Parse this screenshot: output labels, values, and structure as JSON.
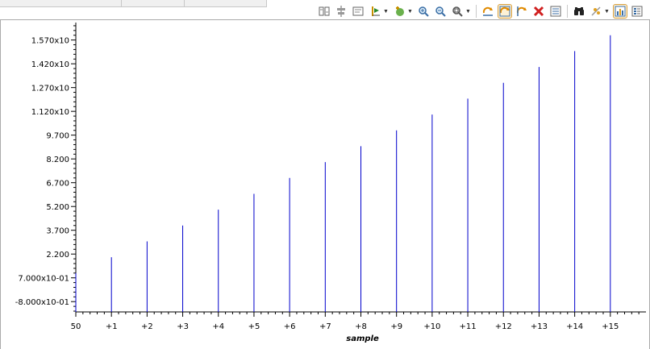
{
  "toolbar": {
    "icons": [
      "align-columns-icon",
      "align-center-icon",
      "frame-icon",
      "cursor-marker-icon",
      "add-point-icon",
      "zoom-in-icon",
      "zoom-out-icon",
      "zoom-fit-icon",
      "autoscale-x-icon",
      "autoscale-xy-icon",
      "autoscale-y-icon",
      "clear-icon",
      "legend-icon",
      "binoculars-icon",
      "plot-style-icon",
      "chart-view-icon",
      "properties-icon"
    ]
  },
  "chart_data": {
    "type": "bar",
    "xlabel": "sample",
    "ylabel": "",
    "x_tick_labels": [
      "50",
      "+1",
      "+2",
      "+3",
      "+4",
      "+5",
      "+6",
      "+7",
      "+8",
      "+9",
      "+10",
      "+11",
      "+12",
      "+13",
      "+14",
      "+15"
    ],
    "y_tick_labels": [
      "-8.000x10-01",
      "7.000x10-01",
      "2.200",
      "3.700",
      "5.200",
      "6.700",
      "8.200",
      "9.700",
      "1.120x10",
      "1.270x10",
      "1.420x10",
      "1.570x10"
    ],
    "y_tick_values": [
      -0.8,
      0.7,
      2.2,
      3.7,
      5.2,
      6.7,
      8.2,
      9.7,
      11.2,
      12.7,
      14.2,
      15.7
    ],
    "x": [
      50,
      51,
      52,
      53,
      54,
      55,
      56,
      57,
      58,
      59,
      60,
      61,
      62,
      63,
      64,
      65
    ],
    "values": [
      1,
      2,
      3,
      4,
      5,
      6,
      7,
      8,
      9,
      10,
      11,
      12,
      13,
      14,
      15,
      16
    ],
    "xlim": [
      50,
      66
    ],
    "ylim": [
      -1.45,
      16.8
    ],
    "series_color": "#0000cc",
    "grid": false
  }
}
